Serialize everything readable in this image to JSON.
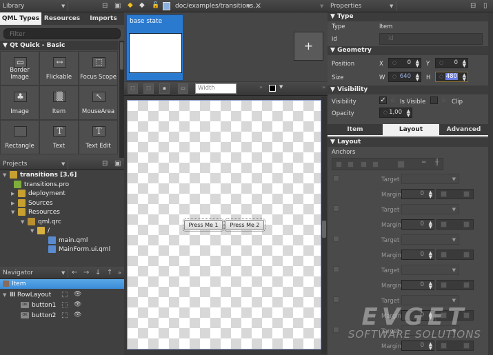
{
  "library": {
    "title": "Library",
    "tabs": [
      "QML Types",
      "Resources",
      "Imports"
    ],
    "active_tab": "QML Types",
    "filter_placeholder": "Filter",
    "section": "Qt Quick - Basic",
    "items": [
      {
        "label": "Border Image",
        "icon": "border-image-icon",
        "glyph": "▭"
      },
      {
        "label": "Flickable",
        "icon": "flickable-icon",
        "glyph": "↔"
      },
      {
        "label": "Focus Scope",
        "icon": "focus-scope-icon",
        "glyph": "⬚"
      },
      {
        "label": "Image",
        "icon": "image-icon",
        "glyph": "♣"
      },
      {
        "label": "Item",
        "icon": "item-icon",
        "glyph": "▒"
      },
      {
        "label": "MouseArea",
        "icon": "mouse-area-icon",
        "glyph": "↖"
      },
      {
        "label": "Rectangle",
        "icon": "rectangle-icon",
        "glyph": ""
      },
      {
        "label": "Text",
        "icon": "text-icon",
        "glyph": "T"
      },
      {
        "label": "Text Edit",
        "icon": "text-edit-icon",
        "glyph": "T"
      }
    ]
  },
  "projects": {
    "title": "Projects",
    "tree": [
      {
        "label": "transitions [3.6]",
        "level": 0,
        "expander": "▼",
        "bold": true,
        "icon": "project-folder-icon"
      },
      {
        "label": "transitions.pro",
        "level": 1,
        "expander": "",
        "icon": "pro-file-icon"
      },
      {
        "label": "deployment",
        "level": 1,
        "expander": "▶",
        "icon": "folder-icon"
      },
      {
        "label": "Sources",
        "level": 1,
        "expander": "▶",
        "icon": "folder-icon"
      },
      {
        "label": "Resources",
        "level": 1,
        "expander": "▼",
        "icon": "folder-icon"
      },
      {
        "label": "qml.qrc",
        "level": 2,
        "expander": "▼",
        "icon": "qrc-file-icon"
      },
      {
        "label": "/",
        "level": 3,
        "expander": "▼",
        "icon": "folder-icon"
      },
      {
        "label": "main.qml",
        "level": 4,
        "expander": "",
        "icon": "qml-file-icon"
      },
      {
        "label": "MainForm.ui.qml",
        "level": 4,
        "expander": "",
        "icon": "qml-file-icon"
      }
    ]
  },
  "navigator": {
    "title": "Navigator",
    "selected": "Item",
    "items": [
      {
        "label": "RowLayout",
        "level": 0
      },
      {
        "label": "button1",
        "level": 1
      },
      {
        "label": "button2",
        "level": 1
      }
    ]
  },
  "editor": {
    "file_path": "doc/examples/transitions...",
    "state_label": "base state",
    "add_state": "+",
    "width_placeholder": "Width",
    "buttons": [
      "Press Me 1",
      "Press Me 2"
    ]
  },
  "properties": {
    "title": "Properties",
    "type_section": "Type",
    "type_label": "Type",
    "type_value": "Item",
    "id_label": "id",
    "id_placeholder": "id",
    "geometry_section": "Geometry",
    "position_label": "Position",
    "size_label": "Size",
    "x_label": "X",
    "x_value": "0",
    "y_label": "Y",
    "y_value": "0",
    "w_label": "W",
    "w_value": "640",
    "h_label": "H",
    "h_value": "480",
    "visibility_section": "Visibility",
    "visibility_label": "Visibility",
    "is_visible_label": "Is Visible",
    "is_visible_checked": true,
    "clip_label": "Clip",
    "clip_checked": false,
    "opacity_label": "Opacity",
    "opacity_value": "1,00",
    "tabs": [
      "Item",
      "Layout",
      "Advanced"
    ],
    "active_tab": "Layout",
    "layout_section": "Layout",
    "anchors_label": "Anchors",
    "target_label": "Target",
    "margin_label": "Margin",
    "margin_value": "0"
  },
  "watermark": {
    "line1": "EVGET",
    "line2": "SOFTWARE SOLUTIONS"
  }
}
